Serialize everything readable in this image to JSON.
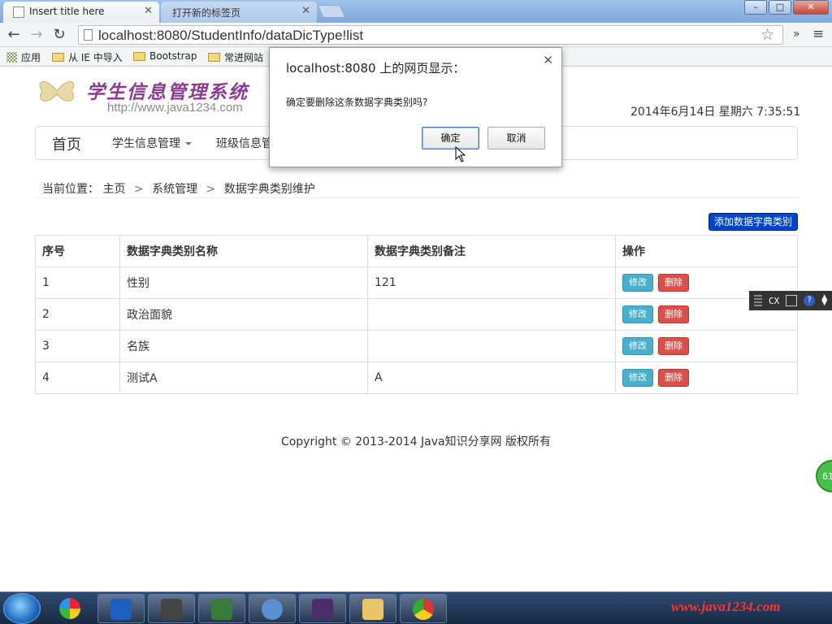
{
  "browser": {
    "tabs": [
      {
        "label": "Insert title here",
        "active": true
      },
      {
        "label": "打开新的标签页",
        "active": false
      }
    ],
    "url": "localhost:8080/StudentInfo/dataDicType!list",
    "bookmarks": [
      "应用",
      "从 IE 中导入",
      "Bootstrap",
      "常进网站"
    ]
  },
  "header": {
    "logo_title": "学生信息管理系统",
    "logo_url": "http://www.java1234.com",
    "datetime": "2014年6月14日 星期六 7:35:51"
  },
  "nav": {
    "home": "首页",
    "items": [
      "学生信息管理",
      "班级信息管"
    ]
  },
  "breadcrumb": {
    "prefix": "当前位置：",
    "items": [
      "主页",
      "系统管理",
      "数据字典类别维护"
    ]
  },
  "actions": {
    "add_label": "添加数据字典类别"
  },
  "table": {
    "headers": [
      "序号",
      "数据字典类别名称",
      "数据字典类别备注",
      "操作"
    ],
    "rows": [
      {
        "id": "1",
        "name": "性别",
        "remark": "121"
      },
      {
        "id": "2",
        "name": "政治面貌",
        "remark": ""
      },
      {
        "id": "3",
        "name": "名族",
        "remark": ""
      },
      {
        "id": "4",
        "name": "测试A",
        "remark": "A"
      }
    ],
    "edit_label": "修改",
    "delete_label": "删除"
  },
  "footer": {
    "copyright": "Copyright © 2013-2014 Java知识分享网 版权所有"
  },
  "dialog": {
    "title": "localhost:8080 上的网页显示：",
    "message": "确定要删除这条数据字典类别吗?",
    "ok_label": "确定",
    "cancel_label": "取消"
  },
  "float_toolbar": {
    "cx_label": "CX",
    "help_label": "?"
  },
  "side_badge": "61",
  "taskbar": {
    "watermark": "www.java1234.com"
  },
  "colors": {
    "primary_button": "#0044cc",
    "edit_button": "#49afcd",
    "delete_button": "#da4f49",
    "logo_text": "#8a3c8e"
  }
}
